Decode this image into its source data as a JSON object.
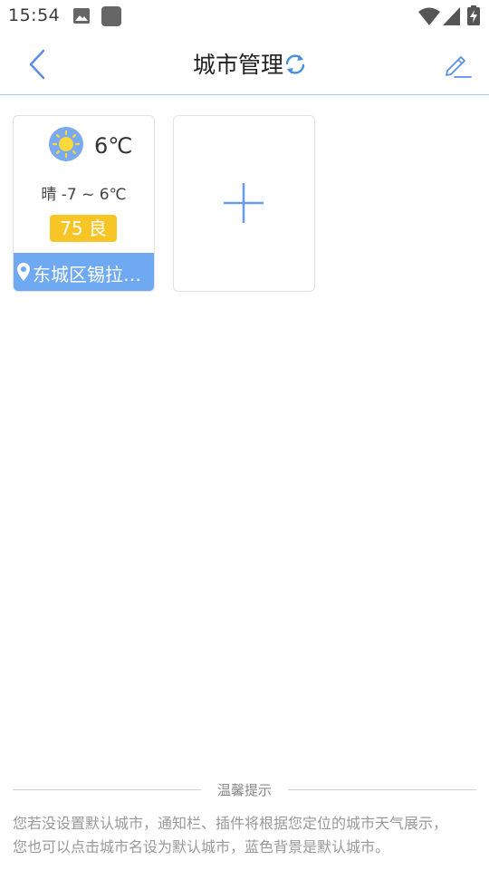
{
  "status_bar": {
    "time": "15:54"
  },
  "header": {
    "title": "城市管理"
  },
  "cities": [
    {
      "weather_icon": "sunny-icon",
      "current_temp": "6℃",
      "range": "晴 -7 ~ 6℃",
      "aqi": "75 良",
      "location": "东城区锡拉…"
    }
  ],
  "add_icon": "plus-icon",
  "tips": {
    "title": "温馨提示",
    "line1": "您若没设置默认城市，通知栏、插件将根据您定位的城市天气展示，",
    "line2": "您也可以点击城市名设为默认城市，蓝色背景是默认城市。"
  },
  "colors": {
    "accent": "#6ea9f2",
    "aqi_good": "#f8c526",
    "divider": "#a9cdea"
  }
}
